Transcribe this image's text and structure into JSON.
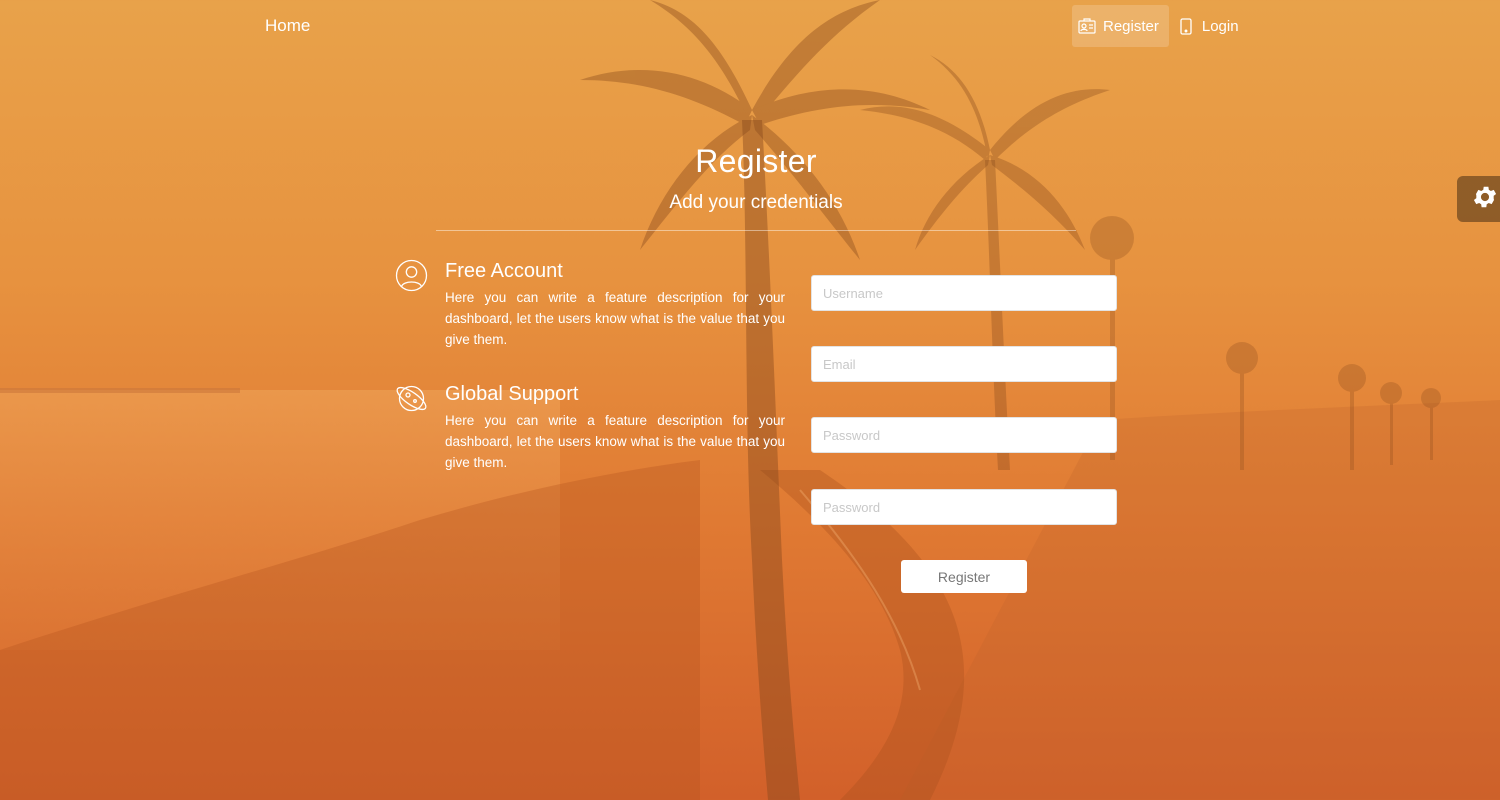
{
  "navbar": {
    "brand": "Home",
    "links": [
      {
        "label": "Register",
        "icon": "id-card-icon",
        "active": true
      },
      {
        "label": "Login",
        "icon": "mobile-phone-icon",
        "active": false
      }
    ]
  },
  "header": {
    "title": "Register",
    "subtitle": "Add your credentials"
  },
  "features": [
    {
      "icon": "user-circle-icon",
      "title": "Free Account",
      "description": "Here you can write a feature description for your dashboard, let the users know what is the value that you give them."
    },
    {
      "icon": "planet-icon",
      "title": "Global Support",
      "description": "Here you can write a feature description for your dashboard, let the users know what is the value that you give them."
    }
  ],
  "form": {
    "username_placeholder": "Username",
    "email_placeholder": "Email",
    "password_placeholder": "Password",
    "password_confirm_placeholder": "Password",
    "submit_label": "Register"
  },
  "settings": {
    "icon": "gear-icon"
  },
  "colors": {
    "overlay_top": "#e8a24a",
    "overlay_bottom": "#d2602a",
    "settings_tab": "#6e461e"
  }
}
